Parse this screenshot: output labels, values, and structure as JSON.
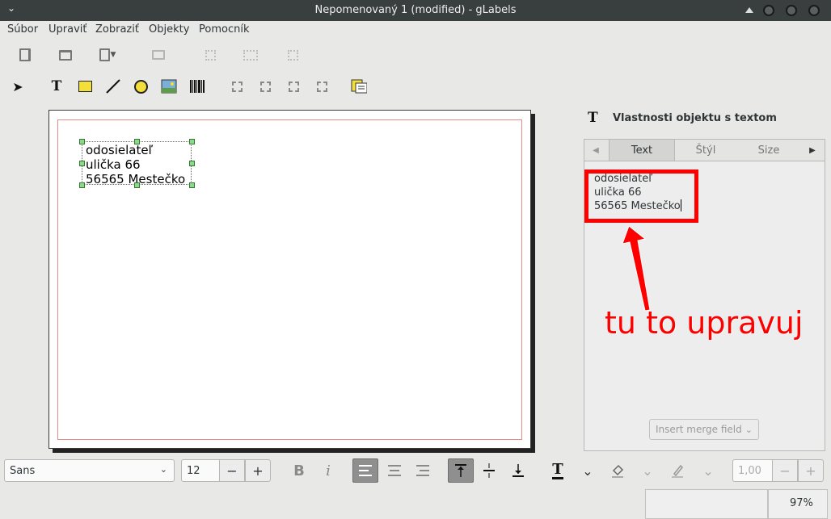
{
  "window": {
    "title": "Nepomenovaný 1 (modified) - gLabels"
  },
  "menu": {
    "items": [
      "Súbor",
      "Upraviť",
      "Zobraziť",
      "Objekty",
      "Pomocník"
    ]
  },
  "toolbar_main": {
    "icons": [
      "new-file-icon",
      "open-folder-icon",
      "save-icon",
      "print-icon",
      "cut-icon",
      "copy-icon",
      "paste-icon"
    ]
  },
  "toolbar_objects": {
    "icons": [
      "pointer-icon",
      "text-tool-icon",
      "box-tool-icon",
      "line-tool-icon",
      "ellipse-tool-icon",
      "image-tool-icon",
      "barcode-tool-icon",
      "zoom-in-icon",
      "zoom-out-icon",
      "zoom-1to1-icon",
      "zoom-fit-icon",
      "merge-properties-icon"
    ]
  },
  "label_object": {
    "lines": "odosielateľ\nulička 66\n56565 Mestečko"
  },
  "properties_panel": {
    "title": "Vlastnosti objektu s textom",
    "tabs": [
      "Text",
      "Štýl",
      "Size"
    ],
    "active_tab": "Text",
    "text_value": "odosielateľ\nulička 66\n56565 Mestečko",
    "merge_button": "Insert merge field"
  },
  "annotation": {
    "text": "tu to upravuj",
    "color": "#ff0000"
  },
  "format_bar": {
    "font_family": "Sans",
    "font_size": "12",
    "bold_label": "B",
    "italic_label": "i",
    "line_spacing": "1,00"
  },
  "statusbar": {
    "zoom": "97%"
  }
}
